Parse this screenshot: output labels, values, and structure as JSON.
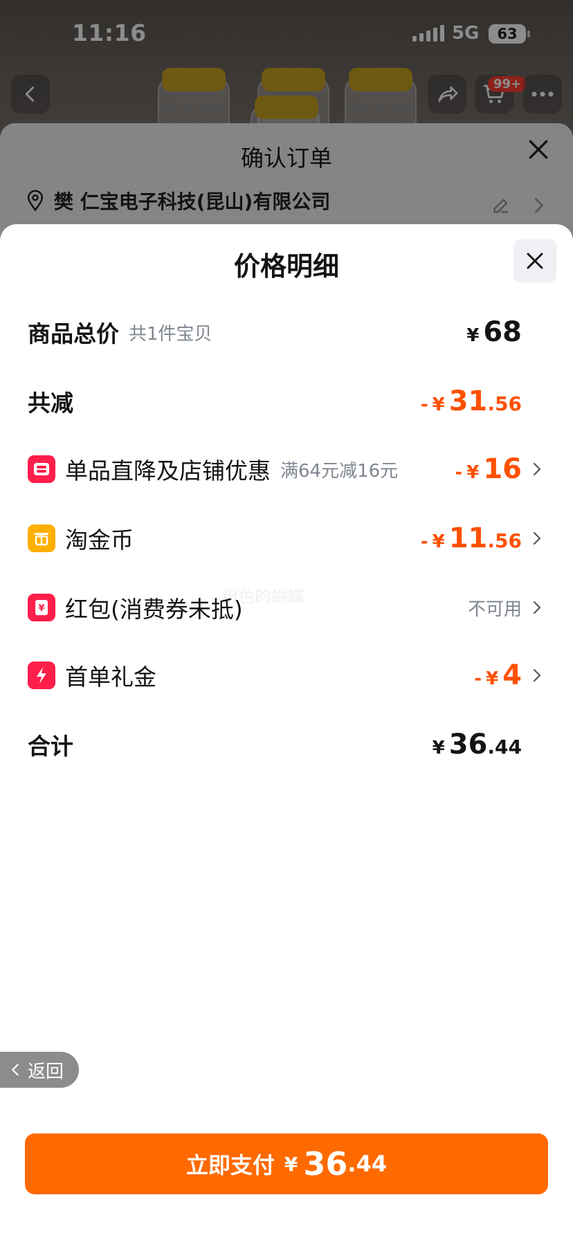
{
  "status_bar": {
    "time": "11:16",
    "network": "5G",
    "battery": "63"
  },
  "background_page": {
    "cart_badge": "99+",
    "icons": {
      "back": "chevron-left-icon",
      "share": "share-icon",
      "cart": "cart-icon",
      "more": "more-icon"
    }
  },
  "order_sheet": {
    "title": "确认订单",
    "address": "樊 仁宝电子科技(昆山)有限公司"
  },
  "price_detail": {
    "title": "价格明细",
    "total_goods": {
      "label": "商品总价",
      "sub": "共1件宝贝",
      "currency": "¥",
      "int": "68",
      "dec": ""
    },
    "total_reduction": {
      "label": "共减",
      "sign": "-",
      "currency": "¥",
      "int": "31",
      "dec": ".56"
    },
    "items": [
      {
        "label": "单品直降及店铺优惠",
        "sub": "满64元减16元",
        "sign": "-",
        "currency": "¥",
        "int": "16",
        "dec": "",
        "icon": "shop-discount-icon",
        "color": "#ff1f4a"
      },
      {
        "label": "淘金币",
        "sub": "",
        "sign": "-",
        "currency": "¥",
        "int": "11",
        "dec": ".56",
        "icon": "coin-icon",
        "color": "#ffb000"
      },
      {
        "label": "红包(消费券未抵)",
        "sub": "",
        "value_text": "不可用",
        "icon": "red-packet-icon",
        "color": "#ff1f4a"
      },
      {
        "label": "首单礼金",
        "sub": "",
        "sign": "-",
        "currency": "¥",
        "int": "4",
        "dec": "",
        "icon": "first-order-gift-icon",
        "color": "#ff1f4a"
      }
    ],
    "total": {
      "label": "合计",
      "currency": "¥",
      "int": "36",
      "dec": ".44"
    }
  },
  "watermark": "粉色的蝴蝶",
  "back_button": {
    "label": "返回"
  },
  "pay_button": {
    "label": "立即支付",
    "currency": "¥",
    "int": "36",
    "dec": ".44"
  },
  "colors": {
    "accent": "#ff6a00",
    "discount": "#ff5000",
    "text": "#141414",
    "muted": "#7f8690"
  }
}
